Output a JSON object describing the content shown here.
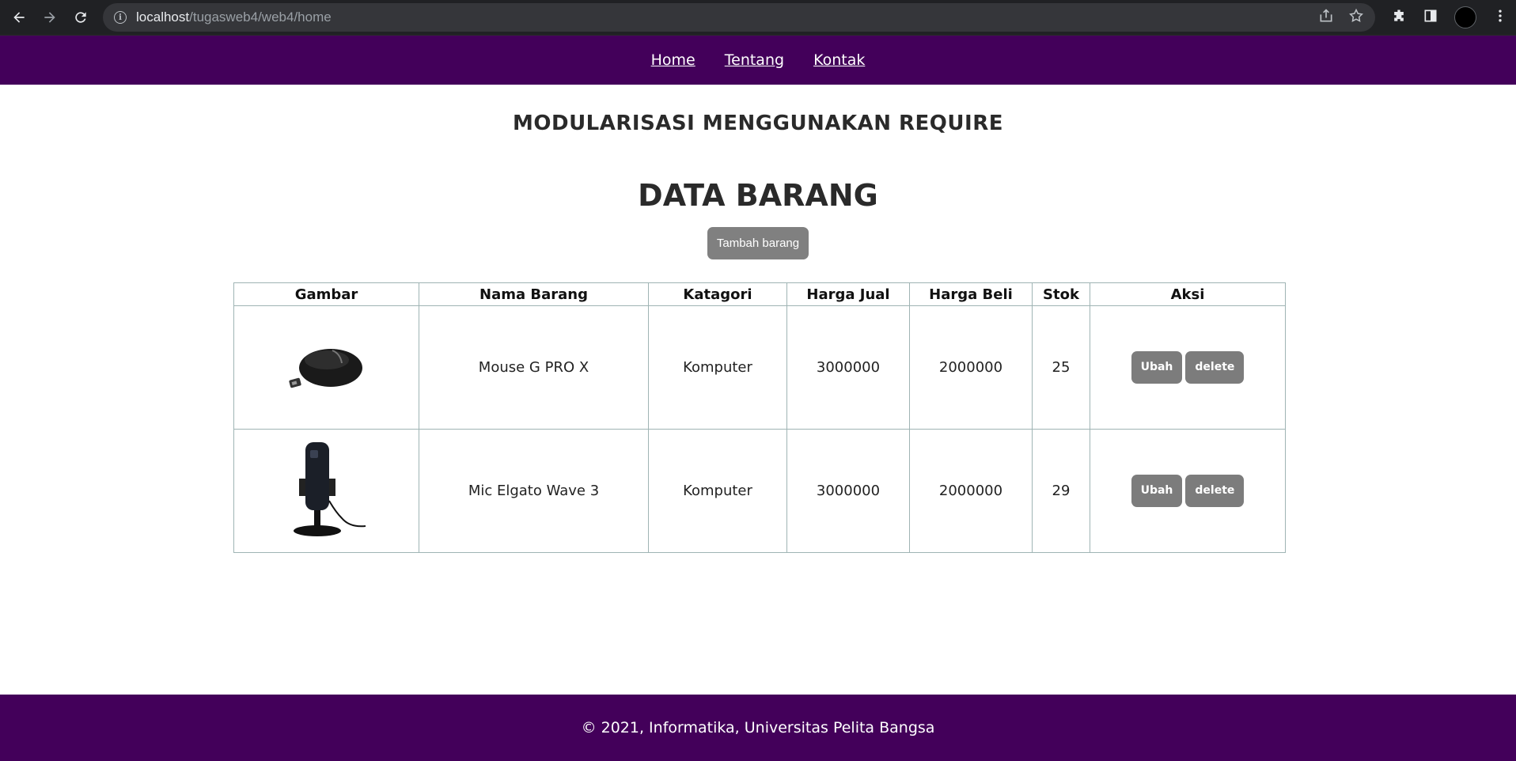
{
  "browser": {
    "url_host": "localhost",
    "url_path": "/tugasweb4/web4/home"
  },
  "nav": {
    "items": [
      {
        "label": "Home"
      },
      {
        "label": "Tentang"
      },
      {
        "label": "Kontak"
      }
    ]
  },
  "page": {
    "subtitle": "MODULARISASI MENGGUNAKAN REQUIRE",
    "title": "DATA BARANG",
    "add_button": "Tambah barang"
  },
  "table": {
    "headers": [
      "Gambar",
      "Nama Barang",
      "Katagori",
      "Harga Jual",
      "Harga Beli",
      "Stok",
      "Aksi"
    ],
    "rows": [
      {
        "image": "mouse-image",
        "name": "Mouse G PRO X",
        "category": "Komputer",
        "sell": "3000000",
        "buy": "2000000",
        "stock": "25",
        "edit": "Ubah",
        "delete": "delete"
      },
      {
        "image": "microphone-image",
        "name": "Mic Elgato Wave 3",
        "category": "Komputer",
        "sell": "3000000",
        "buy": "2000000",
        "stock": "29",
        "edit": "Ubah",
        "delete": "delete"
      }
    ]
  },
  "footer": {
    "text": "© 2021, Informatika, Universitas Pelita Bangsa"
  },
  "colors": {
    "brand": "#43005a",
    "button": "#808080"
  }
}
